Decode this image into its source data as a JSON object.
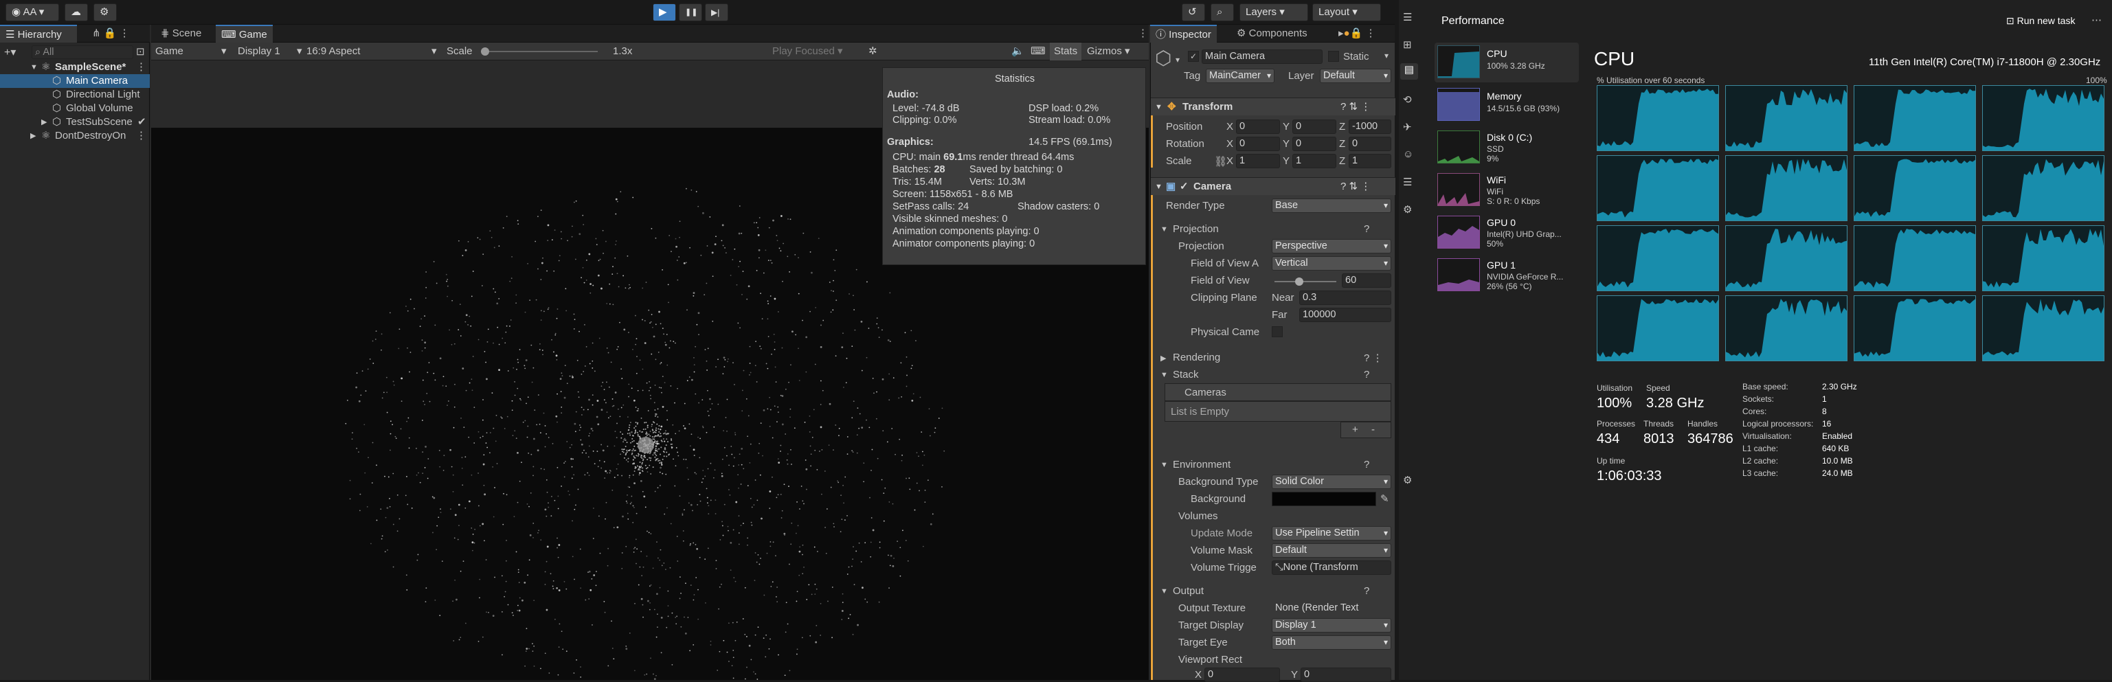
{
  "unity": {
    "topbar": {
      "account": "AA",
      "play": "▶",
      "pause": "❚❚",
      "step": "▶|",
      "layers": "Layers",
      "layout": "Layout"
    },
    "hierarchy": {
      "tab": "Hierarchy",
      "search_placeholder": "All",
      "items": [
        {
          "label": "SampleScene*"
        },
        {
          "label": "Main Camera"
        },
        {
          "label": "Directional Light"
        },
        {
          "label": "Global Volume"
        },
        {
          "label": "TestSubScene"
        },
        {
          "label": "DontDestroyOn"
        }
      ]
    },
    "tabs": {
      "scene": "Scene",
      "game": "Game"
    },
    "game": {
      "mode": "Game",
      "display": "Display 1",
      "aspect": "16:9 Aspect",
      "scale_label": "Scale",
      "scale_value": "1.3x",
      "play_focused": "Play Focused",
      "stats": "Stats",
      "gizmos": "Gizmos"
    },
    "stats": {
      "title": "Statistics",
      "audio": "Audio:",
      "level": "Level: -74.8 dB",
      "clipping": "Clipping: 0.0%",
      "dsp": "DSP load: 0.2%",
      "stream": "Stream load: 0.0%",
      "graphics": "Graphics:",
      "fps": "14.5 FPS (69.1ms)",
      "cpu_main": "CPU: main ",
      "cpu_main_val": "69.1",
      "cpu_rest": "ms  render thread 64.4ms",
      "batches": "Batches: ",
      "batches_val": "28",
      "saved": "Saved by batching: 0",
      "tris": "Tris: 15.4M",
      "verts": "Verts: 10.3M",
      "screen": "Screen: 1158x651 - 8.6 MB",
      "setpass": "SetPass calls: 24",
      "shadow": "Shadow casters: 0",
      "skinned": "Visible skinned meshes: 0",
      "anim": "Animation components playing: 0",
      "animator": "Animator components playing: 0"
    },
    "inspector": {
      "tab_inspector": "Inspector",
      "tab_components": "Components",
      "object": "Main Camera",
      "static": "Static",
      "tag_label": "Tag",
      "tag": "MainCamer",
      "layer_label": "Layer",
      "layer": "Default",
      "transform": "Transform",
      "position": "Position",
      "rotation": "Rotation",
      "scale": "Scale",
      "pos": {
        "x": "0",
        "y": "0",
        "z": "-1000"
      },
      "rot": {
        "x": "0",
        "y": "0",
        "z": "0"
      },
      "scl": {
        "x": "1",
        "y": "1",
        "z": "1"
      },
      "camera": "Camera",
      "render_type_label": "Render Type",
      "render_type": "Base",
      "projection_group": "Projection",
      "projection_label": "Projection",
      "projection": "Perspective",
      "fov_axis_label": "Field of View A",
      "fov_axis": "Vertical",
      "fov_label": "Field of View",
      "fov": "60",
      "clip_label": "Clipping Plane",
      "near_label": "Near",
      "near": "0.3",
      "far_label": "Far",
      "far": "100000",
      "physical_label": "Physical Came",
      "rendering": "Rendering",
      "stack": "Stack",
      "cameras": "Cameras",
      "list_empty": "List is Empty",
      "plus": "+",
      "minus": "-",
      "environment": "Environment",
      "bg_type_label": "Background Type",
      "bg_type": "Solid Color",
      "background_label": "Background",
      "volumes": "Volumes",
      "update_mode_label": "Update Mode",
      "update_mode": "Use Pipeline Settin",
      "volume_mask_label": "Volume Mask",
      "volume_mask": "Default",
      "volume_trigger_label": "Volume Trigge",
      "volume_trigger": "None (Transform",
      "output": "Output",
      "output_texture_label": "Output Texture",
      "output_texture": "None (Render Text",
      "target_display_label": "Target Display",
      "target_display": "Display 1",
      "target_eye_label": "Target Eye",
      "target_eye": "Both",
      "viewport_label": "Viewport Rect",
      "vx": "0",
      "vy": "0",
      "x": "X",
      "y": "Y",
      "z": "Z"
    }
  },
  "taskmgr": {
    "title": "Performance",
    "run_task": "Run new task",
    "cards": [
      {
        "name": "CPU",
        "sub1": "100% 3.28 GHz",
        "sub2": ""
      },
      {
        "name": "Memory",
        "sub1": "14.5/15.6 GB (93%)",
        "sub2": ""
      },
      {
        "name": "Disk 0 (C:)",
        "sub1": "SSD",
        "sub2": "9%"
      },
      {
        "name": "WiFi",
        "sub1": "WiFi",
        "sub2": "S: 0 R: 0 Kbps"
      },
      {
        "name": "GPU 0",
        "sub1": "Intel(R) UHD Grap...",
        "sub2": "50%"
      },
      {
        "name": "GPU 1",
        "sub1": "NVIDIA GeForce R...",
        "sub2": "26% (56 °C)"
      }
    ],
    "cpu_title": "CPU",
    "cpu_model": "11th Gen Intel(R) Core(TM) i7-11800H @ 2.30GHz",
    "graph_caption": "% Utilisation over 60 seconds",
    "graph_max": "100%",
    "utilisation_label": "Utilisation",
    "utilisation": "100%",
    "speed_label": "Speed",
    "speed": "3.28 GHz",
    "processes_label": "Processes",
    "processes": "434",
    "threads_label": "Threads",
    "threads": "8013",
    "handles_label": "Handles",
    "handles": "364786",
    "uptime_label": "Up time",
    "uptime": "1:06:03:33",
    "specs": [
      {
        "k": "Base speed:",
        "v": "2.30 GHz"
      },
      {
        "k": "Sockets:",
        "v": "1"
      },
      {
        "k": "Cores:",
        "v": "8"
      },
      {
        "k": "Logical processors:",
        "v": "16"
      },
      {
        "k": "Virtualisation:",
        "v": "Enabled"
      },
      {
        "k": "L1 cache:",
        "v": "640 KB"
      },
      {
        "k": "L2 cache:",
        "v": "10.0 MB"
      },
      {
        "k": "L3 cache:",
        "v": "24.0 MB"
      }
    ]
  },
  "colors": {
    "accent": "#3a79bb",
    "cpu_graph": "#1aa1c4",
    "orange": "#e8a33a"
  }
}
